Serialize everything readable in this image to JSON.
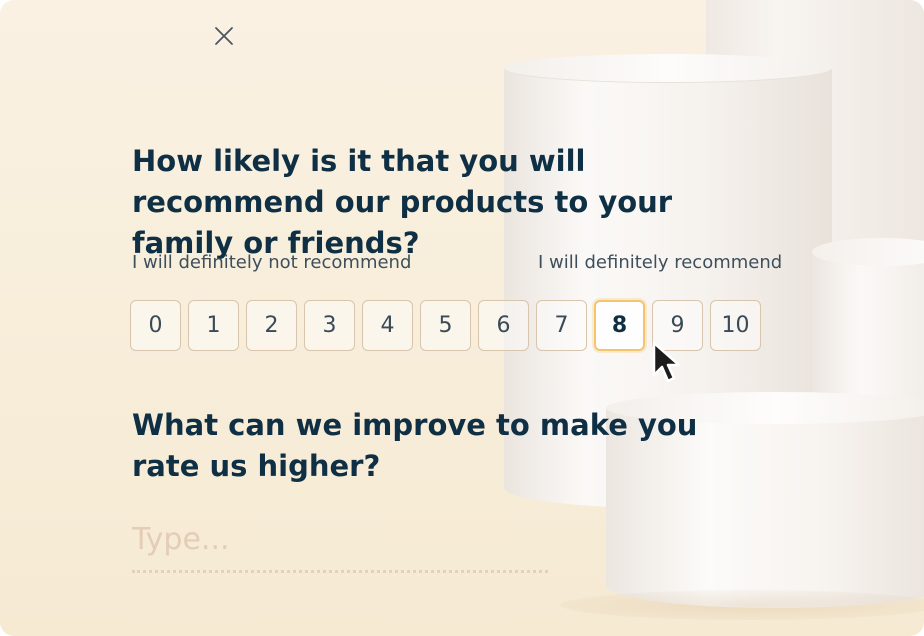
{
  "survey": {
    "close_icon": "close-icon",
    "question_1": "How likely is it that you will recommend our products to your family or friends?",
    "hint_low": "I will definitely not recommend",
    "hint_high": "I will definitely recommend",
    "scale": [
      "0",
      "1",
      "2",
      "3",
      "4",
      "5",
      "6",
      "7",
      "8",
      "9",
      "10"
    ],
    "selected": "8",
    "question_2": "What can we improve to make you rate us higher?",
    "answer_placeholder": "Type...",
    "answer_value": ""
  },
  "colors": {
    "heading": "#0e2f44",
    "selected_border": "#f5c46b",
    "option_border": "#d8c5ae",
    "placeholder": "#e3cdb6",
    "background": "#f8eedb"
  }
}
